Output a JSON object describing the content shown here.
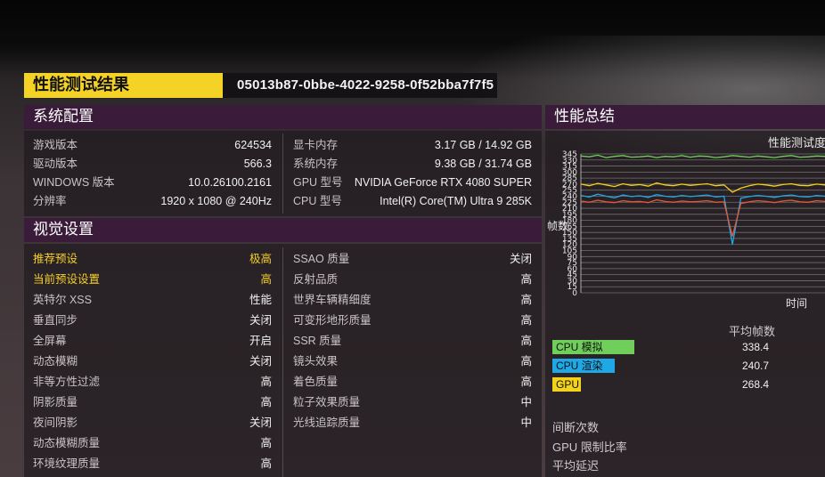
{
  "header": {
    "title": "性能测试结果",
    "run_id": "05013b87-0bbe-4022-9258-0f52bba7f7f5"
  },
  "system_config": {
    "title": "系统配置",
    "left": [
      {
        "label": "游戏版本",
        "value": "624534"
      },
      {
        "label": "驱动版本",
        "value": "566.3"
      },
      {
        "label": "WINDOWS 版本",
        "value": "10.0.26100.2161"
      },
      {
        "label": "分辨率",
        "value": "1920 x 1080 @ 240Hz"
      }
    ],
    "right": [
      {
        "label": "显卡内存",
        "value": "3.17 GB / 14.92 GB"
      },
      {
        "label": "系统内存",
        "value": "9.38 GB / 31.74 GB"
      },
      {
        "label": "GPU 型号",
        "value": "NVIDIA GeForce RTX 4080 SUPER"
      },
      {
        "label": "CPU 型号",
        "value": "Intel(R) Core(TM) Ultra 9 285K"
      }
    ]
  },
  "visual_settings": {
    "title": "视觉设置",
    "left": [
      {
        "label": "推荐预设",
        "value": "极高",
        "highlight": true
      },
      {
        "label": "当前预设设置",
        "value": "高",
        "highlight": true
      },
      {
        "label": "英特尔 XSS",
        "value": "性能"
      },
      {
        "label": "垂直同步",
        "value": "关闭"
      },
      {
        "label": "全屏幕",
        "value": "开启"
      },
      {
        "label": "动态模糊",
        "value": "关闭"
      },
      {
        "label": "非等方性过滤",
        "value": "高"
      },
      {
        "label": "阴影质量",
        "value": "高"
      },
      {
        "label": "夜间阴影",
        "value": "关闭"
      },
      {
        "label": "动态模糊质量",
        "value": "高"
      },
      {
        "label": "环境纹理质量",
        "value": "高"
      }
    ],
    "right": [
      {
        "label": "SSAO 质量",
        "value": "关闭"
      },
      {
        "label": "反射品质",
        "value": "高"
      },
      {
        "label": "世界车辆精细度",
        "value": "高"
      },
      {
        "label": "可变形地形质量",
        "value": "高"
      },
      {
        "label": "SSR 质量",
        "value": "高"
      },
      {
        "label": "镜头效果",
        "value": "高"
      },
      {
        "label": "着色质量",
        "value": "高"
      },
      {
        "label": "粒子效果质量",
        "value": "中"
      },
      {
        "label": "光线追踪质量",
        "value": "中"
      }
    ]
  },
  "performance_summary": {
    "title": "性能总结",
    "chart_title": "性能测试度",
    "y_label": "帧数",
    "x_label": "时间",
    "avg_fps_label": "平均帧数",
    "legend": [
      {
        "label": "CPU 模拟",
        "value": "338.4",
        "color": "#6fcf5a"
      },
      {
        "label": "CPU 渲染",
        "value": "240.7",
        "color": "#1fa8e6"
      },
      {
        "label": "GPU",
        "value": "268.4",
        "color": "#f2d21b"
      }
    ],
    "footer": [
      {
        "label": "间断次数"
      },
      {
        "label": "GPU 限制比率"
      },
      {
        "label": "平均延迟"
      }
    ]
  },
  "chart_data": {
    "type": "line",
    "title": "性能测试度",
    "xlabel": "时间",
    "ylabel": "帧数",
    "ylim": [
      0,
      345
    ],
    "y_ticks": [
      0,
      15,
      30,
      45,
      60,
      75,
      90,
      105,
      120,
      135,
      150,
      165,
      180,
      195,
      210,
      225,
      240,
      255,
      270,
      285,
      300,
      315,
      330,
      345
    ],
    "series": [
      {
        "name": "CPU 模拟",
        "color": "#6fcf5a",
        "values": [
          340,
          338,
          342,
          336,
          339,
          341,
          337,
          338,
          340,
          336,
          339,
          338,
          341,
          337,
          340,
          339,
          336,
          338,
          341,
          339,
          337,
          340,
          338,
          336,
          339,
          341,
          337,
          338,
          340,
          339
        ]
      },
      {
        "name": "CPU 渲染",
        "color": "#1fa8e6",
        "values": [
          242,
          238,
          245,
          240,
          236,
          243,
          239,
          241,
          237,
          244,
          240,
          238,
          242,
          239,
          241,
          243,
          238,
          240,
          120,
          235,
          239,
          242,
          240,
          237,
          241,
          243,
          239,
          238,
          242,
          240
        ]
      },
      {
        "name": "GPU",
        "color": "#f2d21b",
        "values": [
          270,
          266,
          272,
          268,
          264,
          271,
          267,
          269,
          265,
          273,
          268,
          266,
          270,
          267,
          269,
          271,
          266,
          268,
          250,
          260,
          266,
          270,
          268,
          265,
          269,
          271,
          267,
          266,
          270,
          268
        ]
      },
      {
        "name": "",
        "color": "#e05a3a",
        "values": [
          228,
          225,
          230,
          226,
          224,
          229,
          226,
          227,
          224,
          231,
          227,
          225,
          228,
          226,
          227,
          229,
          225,
          226,
          140,
          222,
          226,
          229,
          227,
          224,
          228,
          230,
          226,
          225,
          229,
          227
        ]
      }
    ]
  }
}
